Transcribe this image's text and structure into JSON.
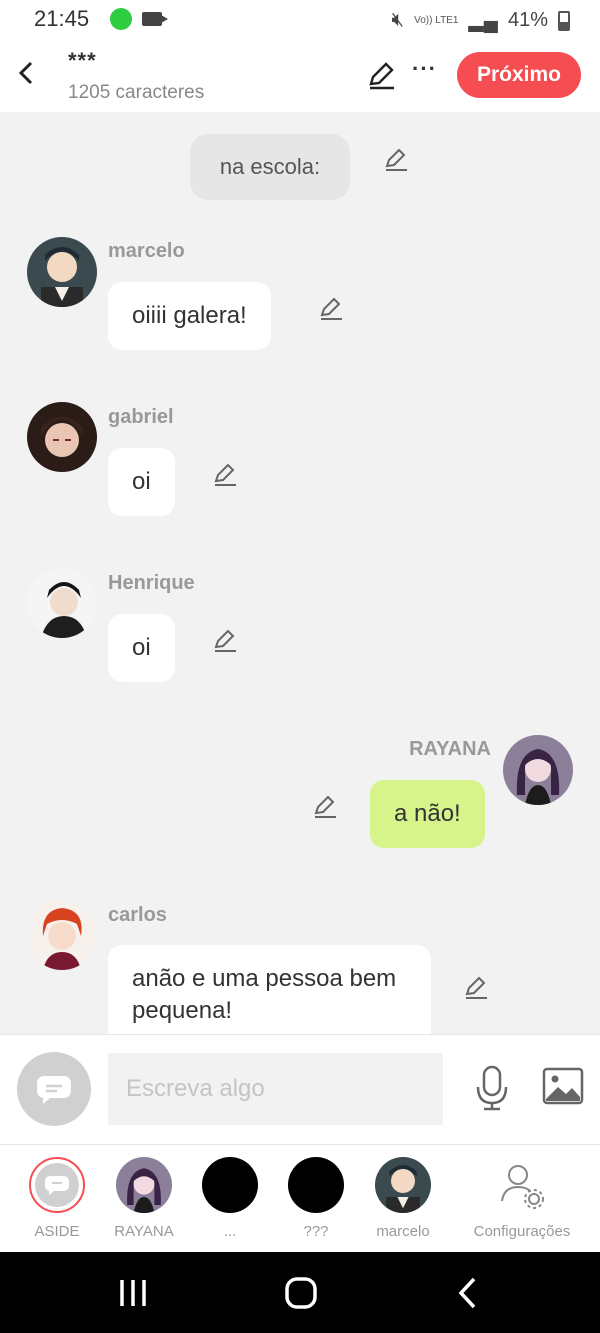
{
  "status": {
    "time": "21:45",
    "battery": "41%",
    "net": "Vo)) LTE1"
  },
  "header": {
    "title": "***",
    "subtitle": "1205 caracteres",
    "next_label": "Próximo"
  },
  "messages": {
    "narration": "na escola:",
    "m1": {
      "name": "marcelo",
      "text": "oiiii galera!"
    },
    "m2": {
      "name": "gabriel",
      "text": "oi"
    },
    "m3": {
      "name": "Henrique",
      "text": "oi"
    },
    "m4": {
      "name": "RAYANA",
      "text": "a não!"
    },
    "m5": {
      "name": "carlos",
      "text": "anão e uma pessoa bem pequena!"
    }
  },
  "input": {
    "placeholder": "Escreva algo"
  },
  "nav": [
    {
      "label": "ASIDE"
    },
    {
      "label": "RAYANA"
    },
    {
      "label": "..."
    },
    {
      "label": "???"
    },
    {
      "label": "marcelo"
    },
    {
      "label": "Configurações"
    }
  ],
  "colors": {
    "accent": "#f64d52",
    "own_bubble": "#d6f48a",
    "narration_bubble": "#e6e6e6"
  }
}
